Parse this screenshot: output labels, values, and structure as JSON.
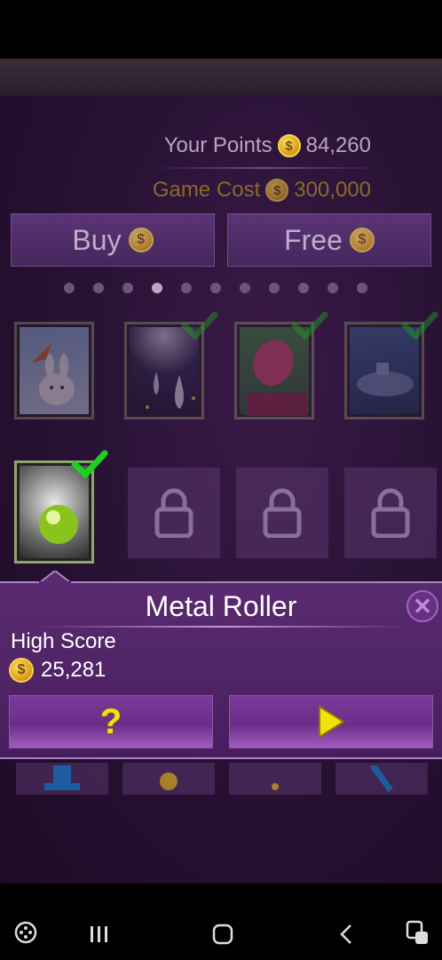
{
  "points": {
    "label": "Your Points",
    "value": "84,260"
  },
  "cost": {
    "label": "Game Cost",
    "value": "300,000"
  },
  "buttons": {
    "buy": "Buy",
    "free": "Free"
  },
  "coin_symbol": "$",
  "page_indicator": {
    "total": 11,
    "active_index": 3
  },
  "games": [
    {
      "name": "card-bunny",
      "unlocked": false
    },
    {
      "name": "card-drops",
      "unlocked": true
    },
    {
      "name": "card-radish",
      "unlocked": true
    },
    {
      "name": "card-submarine",
      "unlocked": true
    },
    {
      "name": "card-metal-roller",
      "unlocked": true,
      "selected": true
    }
  ],
  "panel": {
    "title": "Metal Roller",
    "high_score_label": "High Score",
    "high_score": "25,281",
    "help_symbol": "?",
    "close_symbol": "✕"
  },
  "colors": {
    "accent": "#a784c0",
    "coin": "#f7d24a",
    "check": "#1fa21f",
    "play": "#f2e10a"
  },
  "nav": {
    "icons": [
      "game-launcher-icon",
      "recents-icon",
      "home-icon",
      "back-icon",
      "game-tools-icon"
    ]
  }
}
